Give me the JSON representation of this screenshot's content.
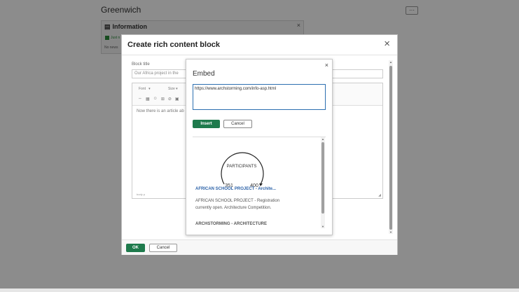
{
  "background": {
    "title": "Greenwich",
    "menu_button": "···",
    "panel": {
      "title": "Information",
      "close": "×",
      "line1": "Just n",
      "line2": "No news"
    }
  },
  "modal": {
    "title": "Create rich content block",
    "close": "×",
    "block_title_label": "Block title",
    "block_title_value": "Our Africa project in the",
    "toolbar": {
      "font": "Font",
      "size": "Size",
      "icons": [
        "⇔",
        "▦",
        "☺",
        "⊞",
        "⊘",
        "▣"
      ]
    },
    "editor_text": "Now there is an article ab",
    "editor_footer": "body  p",
    "ok_label": "OK",
    "cancel_label": "Cancel"
  },
  "embed": {
    "title": "Embed",
    "close": "×",
    "url_value": "https://www.archstorming.com/info-asp.html",
    "insert_label": "Insert",
    "cancel_label": "Cancel",
    "preview": {
      "image_text": "PARTICIPANTS",
      "count_left": "351",
      "count_right": "400",
      "link_title": "AFRICAN SCHOOL PROJECT - Archite...",
      "description": "AFRICAN SCHOOL PROJECT - Registration currently open. Architecture Competition.",
      "source": "ARCHSTORMING - ARCHITECTURE"
    }
  },
  "colors": {
    "accent": "#1e7a4c",
    "link": "#2c62a8",
    "focus": "#2c6fb0"
  }
}
